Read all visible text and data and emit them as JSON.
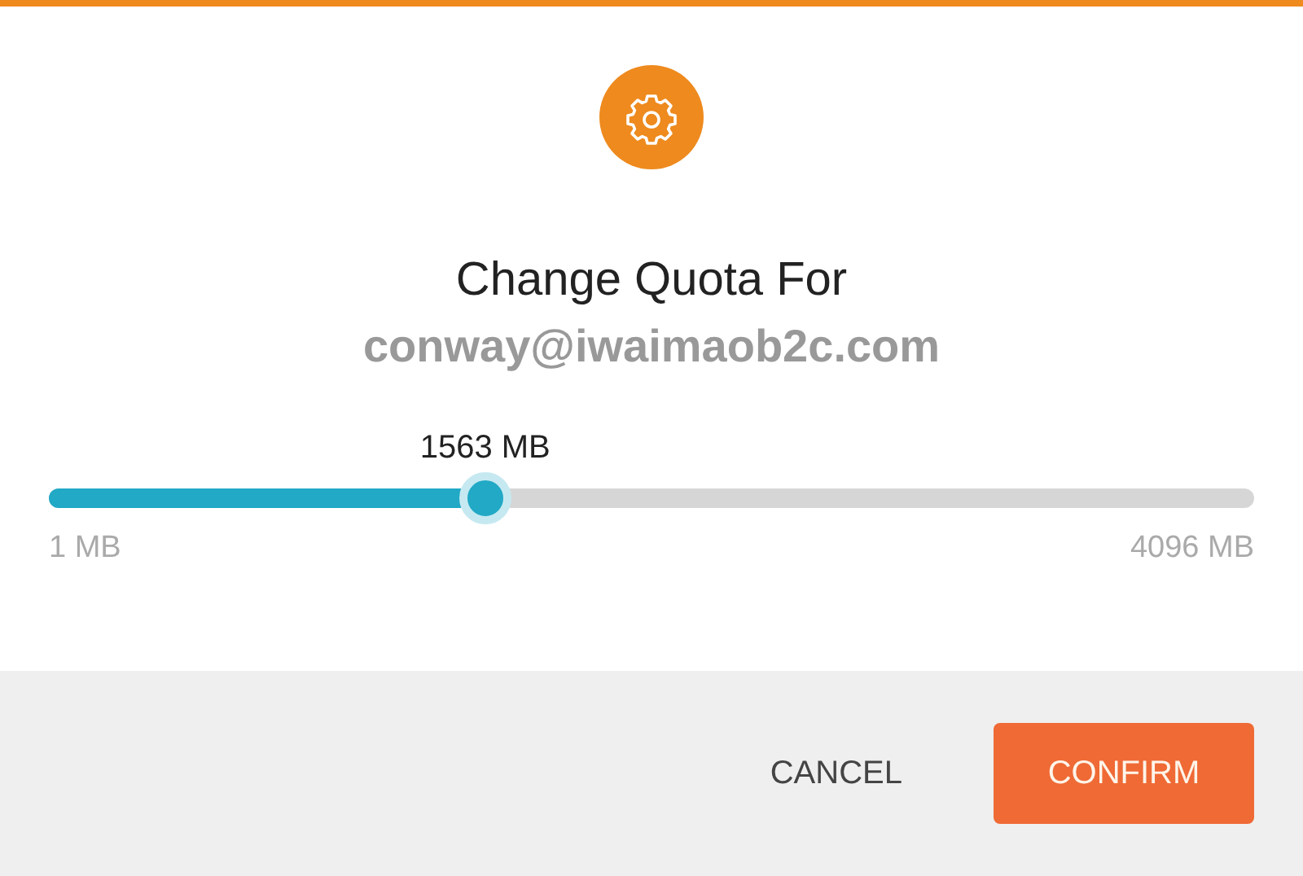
{
  "dialog": {
    "title": "Change Quota For",
    "subtitle": "conway@iwaimaob2c.com"
  },
  "slider": {
    "value_label": "1563 MB",
    "level": 0.362,
    "min_label": "1 MB",
    "max_label": "4096 MB"
  },
  "buttons": [
    {
      "label": "CANCEL",
      "kind": "flat"
    },
    {
      "label": "CONFIRM",
      "kind": "primary"
    }
  ]
}
